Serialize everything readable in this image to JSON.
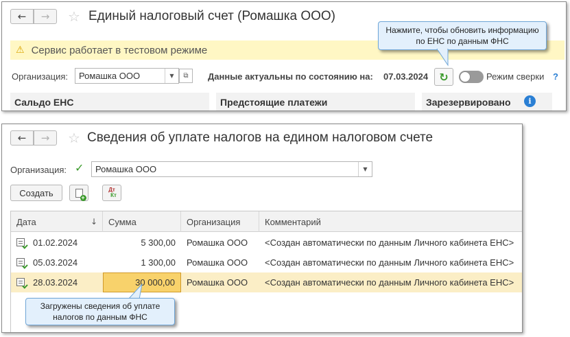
{
  "window1": {
    "title": "Единый налоговый счет (Ромашка ООО)",
    "nav_back": "←",
    "nav_forward": "→",
    "favorite": "☆",
    "banner_text": "Сервис работает в тестовом режиме",
    "org_label": "Организация:",
    "org_value": "Ромашка ООО",
    "data_status_label": "Данные актуальны по состоянию на:",
    "data_status_date": "07.03.2024",
    "refresh": "↻",
    "reconcile_label": "Режим сверки",
    "help": "?",
    "sections": {
      "balance": "Сальдо ЕНС",
      "upcoming": "Предстоящие платежи",
      "reserved": "Зарезервировано"
    },
    "info": "i",
    "callout_text": "Нажмите, чтобы обновить информацию по ЕНС по данным ФНС"
  },
  "window2": {
    "title": "Сведения об уплате налогов на едином налоговом счете",
    "nav_back": "←",
    "nav_forward": "→",
    "favorite": "☆",
    "org_label": "Организация:",
    "org_checked": "✓",
    "org_value": "Ромашка ООО",
    "create_button": "Создать",
    "dtkt_top": "Дт",
    "dtkt_bottom": "Кт",
    "columns": [
      "Дата",
      "Сумма",
      "Организация",
      "Комментарий"
    ],
    "sort_indicator": "↓",
    "rows": [
      {
        "date": "01.02.2024",
        "amount": "5 300,00",
        "org": "Ромашка ООО",
        "comment": "<Создан автоматически по данным Личного кабинета ЕНС>"
      },
      {
        "date": "05.03.2024",
        "amount": "1 300,00",
        "org": "Ромашка ООО",
        "comment": "<Создан автоматически по данным Личного кабинета ЕНС>"
      },
      {
        "date": "28.03.2024",
        "amount": "30 000,00",
        "org": "Ромашка ООО",
        "comment": "<Создан автоматически по данным Личного кабинета ЕНС>"
      }
    ],
    "callout_text": "Загружены сведения об уплате налогов по данным ФНС"
  },
  "colors": {
    "banner_bg": "#fff7c4",
    "selected_row": "#fbeec6",
    "active_cell": "#f8d26b",
    "callout_bg": "#e3f0fc",
    "accent_green": "#3a9a2a",
    "accent_blue": "#2a7fd4"
  }
}
